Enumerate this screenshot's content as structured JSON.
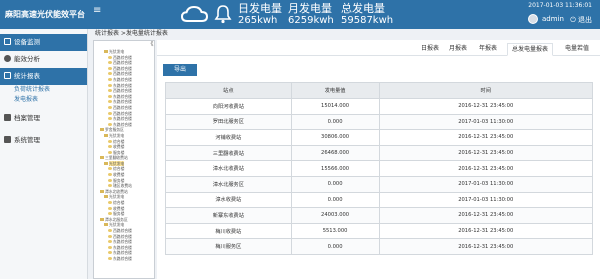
{
  "app": {
    "title": "麻阳高速光伏能效平台",
    "menu_toggle": "≡"
  },
  "header": {
    "stats": [
      {
        "label": "日发电量",
        "value": "265kwh"
      },
      {
        "label": "月发电量",
        "value": "6259kwh"
      },
      {
        "label": "总发电量",
        "value": "59587kwh"
      }
    ],
    "datetime": "2017-01-03 11:36:01",
    "user": "admin",
    "logout": "退出"
  },
  "sidebar": {
    "items": [
      {
        "label": "设备监测",
        "icon": "monitor-icon"
      },
      {
        "label": "能效分析",
        "icon": "chart-icon"
      },
      {
        "label": "统计报表",
        "icon": "report-icon"
      },
      {
        "label": "档案管理",
        "icon": "archive-icon"
      },
      {
        "label": "系统管理",
        "icon": "gear-icon"
      }
    ],
    "subitems": [
      {
        "label": "负荷统计报表"
      },
      {
        "label": "发电报表"
      }
    ]
  },
  "breadcrumb": "统计报表 >发电量统计报表",
  "tree": {
    "scroll": "《",
    "nodes": [
      {
        "label": "光伏发电",
        "depth": 2,
        "kind": "folder"
      },
      {
        "label": "西路综合楼",
        "depth": 3,
        "kind": "leaf"
      },
      {
        "label": "西路综合楼",
        "depth": 3,
        "kind": "leaf"
      },
      {
        "label": "西路综合楼",
        "depth": 3,
        "kind": "leaf"
      },
      {
        "label": "西路综合楼",
        "depth": 3,
        "kind": "leaf"
      },
      {
        "label": "东路综合楼",
        "depth": 3,
        "kind": "leaf"
      },
      {
        "label": "东路综合楼",
        "depth": 3,
        "kind": "leaf"
      },
      {
        "label": "西路综合楼",
        "depth": 3,
        "kind": "leaf"
      },
      {
        "label": "东路综合楼",
        "depth": 3,
        "kind": "leaf"
      },
      {
        "label": "东路综合楼",
        "depth": 3,
        "kind": "leaf"
      },
      {
        "label": "西路综合楼",
        "depth": 3,
        "kind": "leaf"
      },
      {
        "label": "西路综合楼",
        "depth": 3,
        "kind": "leaf"
      },
      {
        "label": "东路综合楼",
        "depth": 3,
        "kind": "leaf"
      },
      {
        "label": "东路综合楼",
        "depth": 3,
        "kind": "leaf"
      },
      {
        "label": "罗舍服务区",
        "depth": 1,
        "kind": "folder"
      },
      {
        "label": "光伏发电",
        "depth": 2,
        "kind": "folder"
      },
      {
        "label": "综合楼",
        "depth": 3,
        "kind": "leaf"
      },
      {
        "label": "收费楼",
        "depth": 3,
        "kind": "leaf"
      },
      {
        "label": "服务楼",
        "depth": 3,
        "kind": "leaf"
      },
      {
        "label": "三里翻收费站",
        "depth": 1,
        "kind": "folder"
      },
      {
        "label": "光伏发电",
        "depth": 2,
        "kind": "folder",
        "selected": true
      },
      {
        "label": "综合楼",
        "depth": 3,
        "kind": "leaf"
      },
      {
        "label": "收费楼",
        "depth": 3,
        "kind": "leaf"
      },
      {
        "label": "服务楼",
        "depth": 3,
        "kind": "leaf"
      },
      {
        "label": "辖区收费站",
        "depth": 3,
        "kind": "leaf"
      },
      {
        "label": "潭水北收费站",
        "depth": 1,
        "kind": "folder"
      },
      {
        "label": "光伏发电",
        "depth": 2,
        "kind": "folder"
      },
      {
        "label": "综合楼",
        "depth": 3,
        "kind": "leaf"
      },
      {
        "label": "收费楼",
        "depth": 3,
        "kind": "leaf"
      },
      {
        "label": "服务楼",
        "depth": 3,
        "kind": "leaf"
      },
      {
        "label": "潭水北服务区",
        "depth": 1,
        "kind": "folder"
      },
      {
        "label": "光伏发电",
        "depth": 2,
        "kind": "folder"
      },
      {
        "label": "西路综合楼",
        "depth": 3,
        "kind": "leaf"
      },
      {
        "label": "西路综合楼",
        "depth": 3,
        "kind": "leaf"
      },
      {
        "label": "东路综合楼",
        "depth": 3,
        "kind": "leaf"
      },
      {
        "label": "东路综合楼",
        "depth": 3,
        "kind": "leaf"
      },
      {
        "label": "东路综合楼",
        "depth": 3,
        "kind": "leaf"
      },
      {
        "label": "东路综合楼",
        "depth": 3,
        "kind": "leaf"
      }
    ]
  },
  "tabs": [
    {
      "label": "日报表"
    },
    {
      "label": "月报表"
    },
    {
      "label": "年报表"
    },
    {
      "label": "总发电量报表",
      "active": true
    },
    {
      "label": "电量若值"
    }
  ],
  "export_label": "导出",
  "table": {
    "headers": [
      "站点",
      "发电量值",
      "时间"
    ],
    "rows": [
      [
        "向阳河收费站",
        "15014.000",
        "2016-12-31 23:45:00"
      ],
      [
        "罗田北服务区",
        "0.000",
        "2017-01-03 11:30:00"
      ],
      [
        "河铺收费站",
        "30806.000",
        "2016-12-31 23:45:00"
      ],
      [
        "三里翻收费站",
        "26468.000",
        "2016-12-31 23:45:00"
      ],
      [
        "漳水北收费站",
        "15566.000",
        "2016-12-31 23:45:00"
      ],
      [
        "漳水北服务区",
        "0.000",
        "2017-01-03 11:30:00"
      ],
      [
        "漳水收费站",
        "0.000",
        "2017-01-03 11:30:00"
      ],
      [
        "新寨东收费站",
        "24003.000",
        "2016-12-31 23:45:00"
      ],
      [
        "梅川收费站",
        "5513.000",
        "2016-12-31 23:45:00"
      ],
      [
        "梅川服务区",
        "0.000",
        "2016-12-31 23:45:00"
      ]
    ]
  },
  "colors": {
    "brand": "#2e72a8",
    "header_bg": "#2e72a8",
    "folder": "#d9b85a"
  }
}
